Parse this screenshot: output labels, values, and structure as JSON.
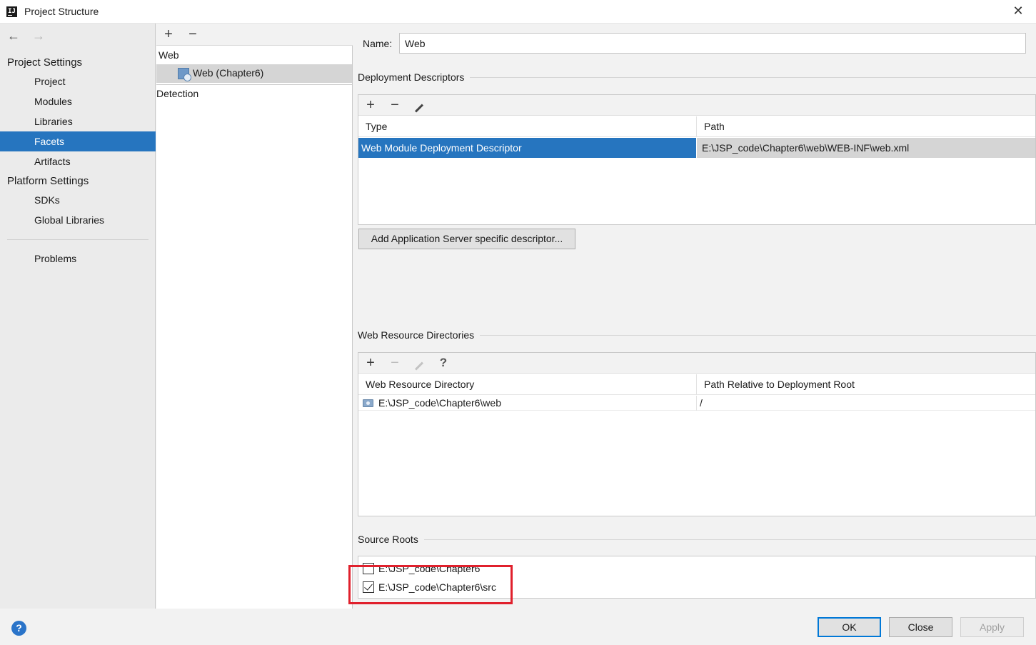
{
  "window": {
    "title": "Project Structure",
    "close_glyph": "✕"
  },
  "nav": {
    "back_glyph": "←",
    "forward_glyph": "→",
    "project_settings_header": "Project Settings",
    "project_settings_items": [
      "Project",
      "Modules",
      "Libraries",
      "Facets",
      "Artifacts"
    ],
    "platform_settings_header": "Platform Settings",
    "platform_settings_items": [
      "SDKs",
      "Global Libraries"
    ],
    "problems": "Problems",
    "selected": "Facets"
  },
  "facets_panel": {
    "add_glyph": "+",
    "remove_glyph": "−",
    "group": "Web",
    "facet_item": "Web (Chapter6)",
    "detection": "Detection"
  },
  "details": {
    "name_label": "Name:",
    "name_value": "Web",
    "deployment_descriptors": {
      "title": "Deployment Descriptors",
      "add_glyph": "+",
      "remove_glyph": "−",
      "columns": [
        "Type",
        "Path"
      ],
      "rows": [
        {
          "type": "Web Module Deployment Descriptor",
          "path": "E:\\JSP_code\\Chapter6\\web\\WEB-INF\\web.xml"
        }
      ],
      "add_server_button": "Add Application Server specific descriptor..."
    },
    "web_resource_directories": {
      "title": "Web Resource Directories",
      "add_glyph": "+",
      "remove_glyph": "−",
      "help_glyph": "?",
      "columns": [
        "Web Resource Directory",
        "Path Relative to Deployment Root"
      ],
      "rows": [
        {
          "directory": "E:\\JSP_code\\Chapter6\\web",
          "relative_path": "/"
        }
      ]
    },
    "source_roots": {
      "title": "Source Roots",
      "items": [
        {
          "path": "E:\\JSP_code\\Chapter6",
          "checked": false
        },
        {
          "path": "E:\\JSP_code\\Chapter6\\src",
          "checked": true
        }
      ]
    }
  },
  "footer": {
    "help_glyph": "?",
    "ok": "OK",
    "close": "Close",
    "apply": "Apply"
  },
  "colors": {
    "selection": "#2675bf",
    "highlight_annotation": "#e0202c",
    "default_button_border": "#0078d7"
  }
}
